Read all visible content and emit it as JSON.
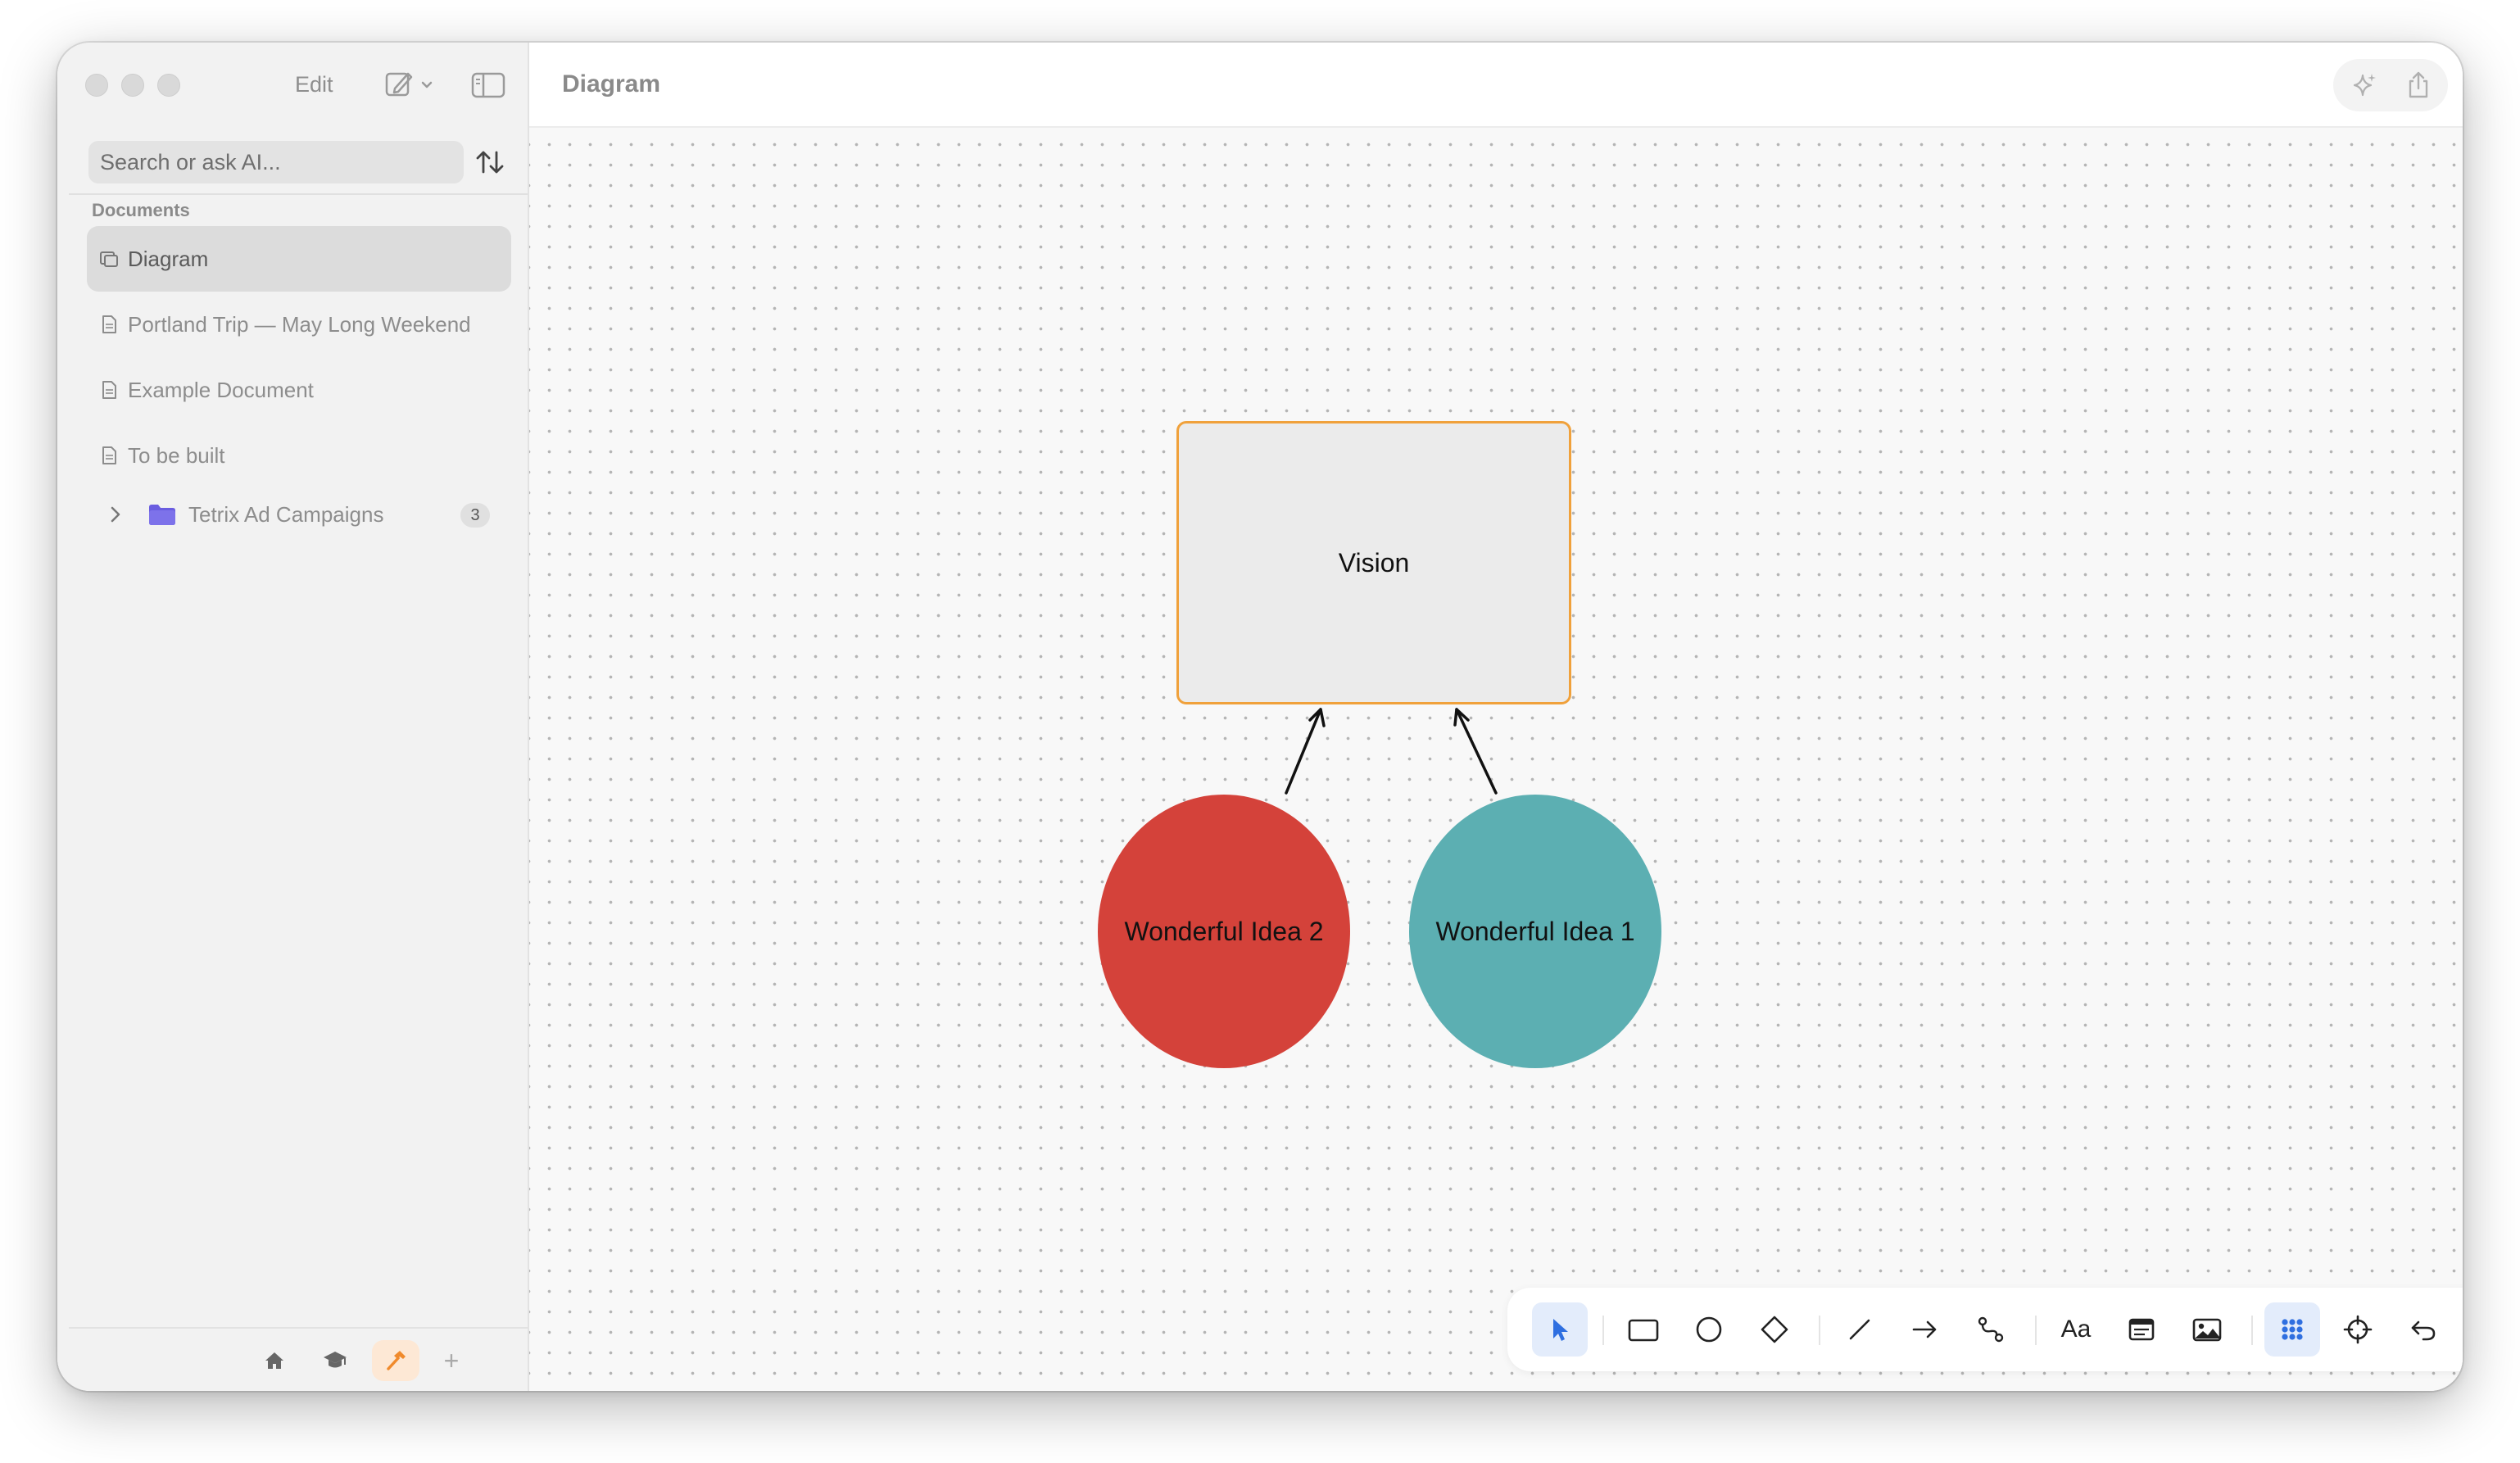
{
  "window": {
    "edit_label": "Edit"
  },
  "sidebar": {
    "search_placeholder": "Search or ask AI...",
    "section_label": "Documents",
    "items": [
      {
        "label": "Diagram",
        "icon": "diagram-icon",
        "selected": true
      },
      {
        "label": "Portland Trip — May Long Weekend",
        "icon": "document-icon",
        "selected": false
      },
      {
        "label": "Example Document",
        "icon": "document-icon",
        "selected": false
      },
      {
        "label": "To be built",
        "icon": "document-icon",
        "selected": false
      }
    ],
    "folder": {
      "label": "Tetrix Ad Campaigns",
      "count": "3",
      "icon": "folder-icon",
      "color": "#6a5de0"
    },
    "bottom_tabs": [
      {
        "icon": "home-icon"
      },
      {
        "icon": "graduation-cap-icon"
      },
      {
        "icon": "hammer-icon",
        "active": true,
        "color": "#f08a2c"
      },
      {
        "icon": "plus-icon",
        "label": "+"
      }
    ]
  },
  "header": {
    "title": "Diagram",
    "buttons": [
      {
        "icon": "sparkle-icon"
      },
      {
        "icon": "share-icon"
      }
    ]
  },
  "canvas": {
    "nodes": [
      {
        "id": "vision",
        "shape": "rectangle",
        "label": "Vision",
        "fill": "#ebebeb",
        "stroke": "#f0a13b"
      },
      {
        "id": "idea2",
        "shape": "ellipse",
        "label": "Wonderful Idea 2",
        "fill": "#d4423a"
      },
      {
        "id": "idea1",
        "shape": "ellipse",
        "label": "Wonderful Idea 1",
        "fill": "#5cafb2"
      }
    ],
    "edges": [
      {
        "from": "idea2",
        "to": "vision"
      },
      {
        "from": "idea1",
        "to": "vision"
      }
    ]
  },
  "toolbar": {
    "tools": [
      {
        "name": "select-tool",
        "icon": "cursor-icon",
        "active": true
      },
      {
        "name": "rectangle-tool",
        "icon": "rectangle-icon"
      },
      {
        "name": "ellipse-tool",
        "icon": "circle-icon"
      },
      {
        "name": "diamond-tool",
        "icon": "diamond-icon"
      },
      {
        "name": "line-tool",
        "icon": "line-icon"
      },
      {
        "name": "arrow-tool",
        "icon": "arrow-right-icon"
      },
      {
        "name": "connector-tool",
        "icon": "connector-icon"
      },
      {
        "name": "text-tool",
        "icon": "text-icon",
        "label": "Aa"
      },
      {
        "name": "note-tool",
        "icon": "note-icon"
      },
      {
        "name": "image-tool",
        "icon": "image-icon"
      },
      {
        "name": "grid-toggle",
        "icon": "grid-icon",
        "active": true
      },
      {
        "name": "focus-tool",
        "icon": "crosshair-icon"
      },
      {
        "name": "undo-button",
        "icon": "undo-icon"
      },
      {
        "name": "redo-button",
        "icon": "redo-icon",
        "disabled": true
      }
    ],
    "accent": "#2f6fe0"
  }
}
